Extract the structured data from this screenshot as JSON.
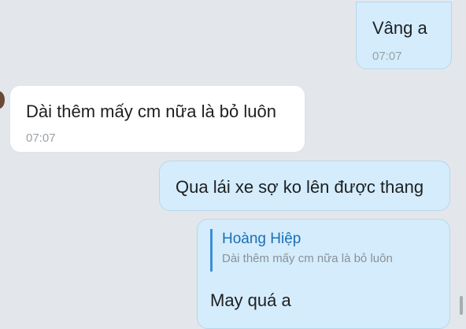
{
  "messages": [
    {
      "direction": "sent",
      "text": "Vâng a",
      "time": "07:07"
    },
    {
      "direction": "received",
      "text": "Dài thêm mấy cm nữa là bỏ luôn",
      "time": "07:07"
    },
    {
      "direction": "sent",
      "text": "Qua lái xe sợ ko lên được thang"
    },
    {
      "direction": "sent",
      "reply_to": {
        "author": "Hoàng Hiệp",
        "text": "Dài thêm mấy cm nữa là bỏ luôn"
      },
      "text": "May quá a"
    }
  ],
  "colors": {
    "background": "#e3e7ec",
    "sent_bubble": "#d4ecfb",
    "received_bubble": "#ffffff",
    "reply_accent": "#3d8ed6",
    "reply_author": "#1b6fb8",
    "timestamp": "#9aa1a9"
  }
}
